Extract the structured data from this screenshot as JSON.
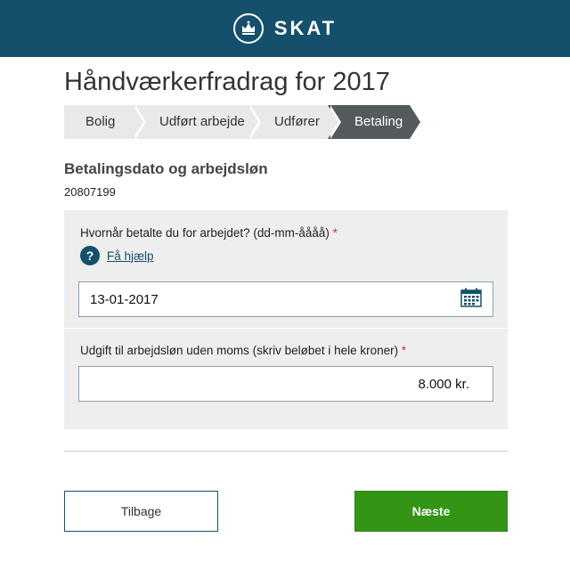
{
  "header": {
    "brand": "SKAT",
    "bg_color": "#14506b"
  },
  "page": {
    "title": "Håndværkerfradrag for 2017"
  },
  "steps": [
    {
      "label": "Bolig",
      "active": false
    },
    {
      "label": "Udført arbejde",
      "active": false
    },
    {
      "label": "Udfører",
      "active": false
    },
    {
      "label": "Betaling",
      "active": true
    }
  ],
  "section": {
    "title": "Betalingsdato og arbejdsløn",
    "ref_number": "20807199"
  },
  "form": {
    "date_label": "Hvornår betalte du for arbejdet? (dd-mm-åååå)",
    "required_mark": "*",
    "help_icon": "?",
    "help_link": "Få hjælp",
    "date_value": "13-01-2017",
    "amount_label": "Udgift til arbejdsløn uden moms (skriv beløbet i hele kroner)",
    "amount_value": "8.000 kr."
  },
  "buttons": {
    "back": "Tilbage",
    "next": "Næste",
    "next_color": "#339415"
  }
}
